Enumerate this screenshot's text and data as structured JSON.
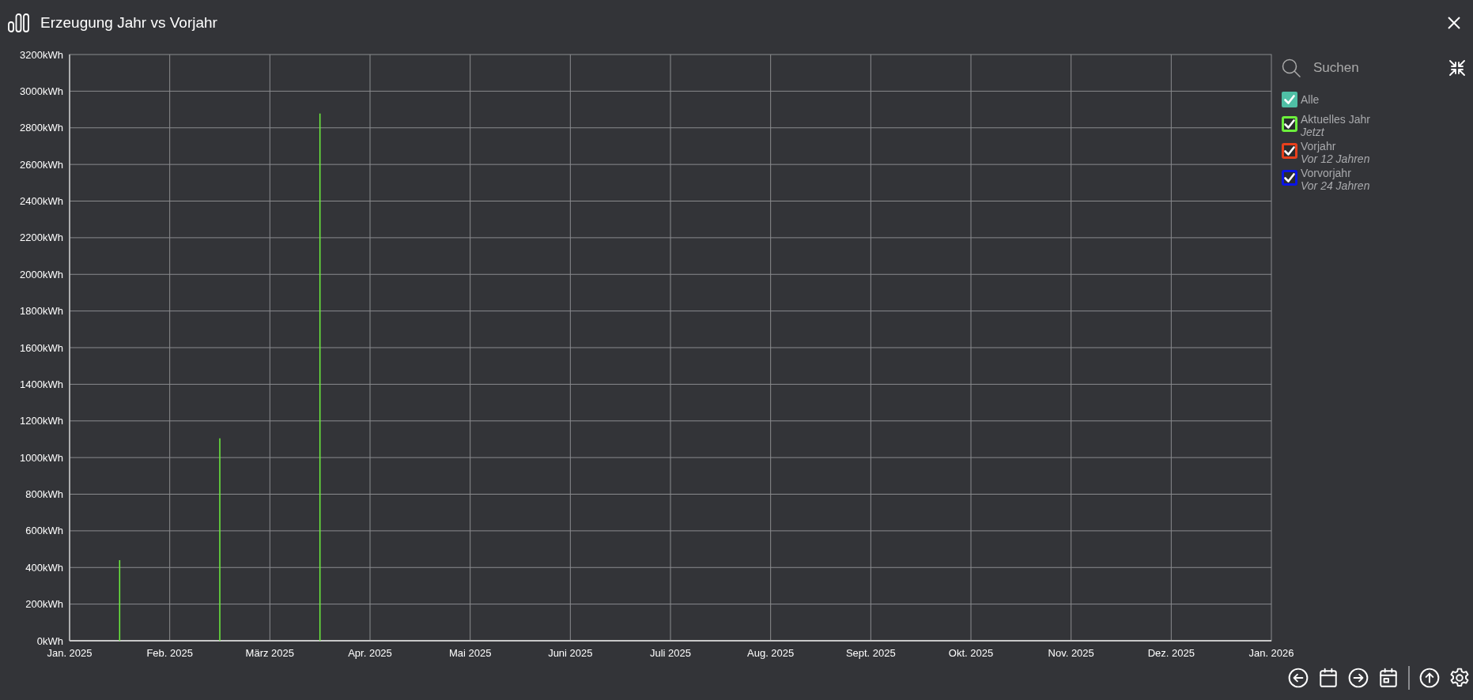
{
  "header": {
    "title": "Erzeugung Jahr vs Vorjahr"
  },
  "chart": {
    "chart_data": {
      "type": "bar",
      "grid": true,
      "ylim": [
        0,
        3200
      ],
      "categories": [
        "Jan. 2025",
        null,
        "Feb. 2025",
        null,
        "März 2025",
        null,
        "Apr. 2025",
        null,
        "Mai 2025",
        null,
        "Juni 2025",
        null,
        "Juli 2025",
        null,
        "Aug. 2025",
        null,
        "Sept. 2025",
        null,
        "Okt. 2025",
        null,
        "Nov. 2025",
        null,
        "Dez. 2025",
        null,
        "Jan. 2026"
      ],
      "yticks": [
        {
          "value": 0,
          "label": "0kWh"
        },
        {
          "value": 200,
          "label": "200kWh"
        },
        {
          "value": 400,
          "label": "400kWh"
        },
        {
          "value": 600,
          "label": "600kWh"
        },
        {
          "value": 800,
          "label": "800kWh"
        },
        {
          "value": 1000,
          "label": "1000kWh"
        },
        {
          "value": 1200,
          "label": "1200kWh"
        },
        {
          "value": 1400,
          "label": "1400kWh"
        },
        {
          "value": 1600,
          "label": "1600kWh"
        },
        {
          "value": 1800,
          "label": "1800kWh"
        },
        {
          "value": 2000,
          "label": "2000kWh"
        },
        {
          "value": 2200,
          "label": "2200kWh"
        },
        {
          "value": 2400,
          "label": "2400kWh"
        },
        {
          "value": 2600,
          "label": "2600kWh"
        },
        {
          "value": 2800,
          "label": "2800kWh"
        },
        {
          "value": 3000,
          "label": "3000kWh"
        },
        {
          "value": 3200,
          "label": "3200kWh"
        }
      ],
      "series": [
        {
          "name": "Aktuelles Jahr",
          "color": "#6cf03c",
          "values": [
            null,
            440,
            null,
            1105,
            null,
            2878,
            null,
            null,
            null,
            null,
            null,
            null,
            null,
            null,
            null,
            null,
            null,
            null,
            null,
            null,
            null,
            null,
            null,
            null,
            null
          ]
        },
        {
          "name": "Vorjahr",
          "color": "#e8401c",
          "values": [
            null,
            null,
            null,
            null,
            null,
            null,
            null,
            null,
            null,
            null,
            null,
            null,
            null,
            null,
            null,
            null,
            null,
            null,
            null,
            null,
            null,
            null,
            null,
            null,
            null
          ]
        },
        {
          "name": "Vorvorjahr",
          "color": "#0a14e6",
          "values": [
            null,
            null,
            null,
            null,
            null,
            null,
            null,
            null,
            null,
            null,
            null,
            null,
            null,
            null,
            null,
            null,
            null,
            null,
            null,
            null,
            null,
            null,
            null,
            null,
            null
          ]
        }
      ]
    }
  },
  "legend": {
    "search": {
      "placeholder": "Suchen"
    },
    "all": {
      "label": "Alle",
      "checked": true
    },
    "items": [
      {
        "sublabel": "Jetzt",
        "checked": true
      },
      {
        "sublabel": "Vor 12 Jahren",
        "checked": true
      },
      {
        "sublabel": "Vor 24 Jahren",
        "checked": true
      }
    ]
  }
}
